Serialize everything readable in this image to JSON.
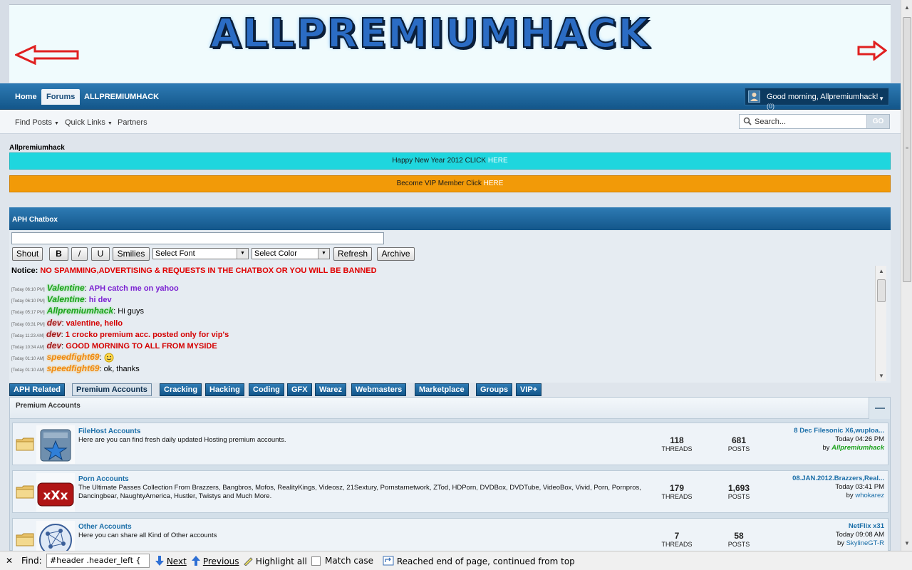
{
  "banner": {
    "logo_text": "ALLPREMIUMHACK"
  },
  "nav": {
    "tabs": [
      "Home",
      "Forums",
      "ALLPREMIUMHACK"
    ],
    "user_greeting": "Good morning, Allpremiumhack!",
    "user_count": "(0)"
  },
  "subnav": {
    "items": [
      "Find Posts",
      "Quick Links",
      "Partners"
    ],
    "search_placeholder": "Search...",
    "search_go": "GO"
  },
  "breadcrumb": "Allpremiumhack",
  "notices": {
    "newyear_text": "Happy New Year 2012 CLICK ",
    "newyear_link": "HERE",
    "vip_text": "Become VIP Member Click ",
    "vip_link": "HERE"
  },
  "chatbox": {
    "title": "APH Chatbox",
    "buttons": {
      "shout": "Shout",
      "bold": "B",
      "italic": "/",
      "underline": "U",
      "smilies": "Smilies",
      "refresh": "Refresh",
      "archive": "Archive"
    },
    "select_font": "Select Font",
    "select_color": "Select Color",
    "notice_label": "Notice:",
    "notice_text": "NO SPAMMING,ADVERTISING & REQUESTS IN THE CHATBOX OR YOU WILL BE BANNED",
    "messages": [
      {
        "time": "[Today 06:10 PM]",
        "user": "Valentine",
        "text": "APH catch me on yahoo"
      },
      {
        "time": "[Today 06:10 PM]",
        "user": "Valentine",
        "text": "hi dev"
      },
      {
        "time": "[Today 05:17 PM]",
        "user": "Allpremiumhack",
        "text": "Hi guys"
      },
      {
        "time": "[Today 03:31 PM]",
        "user": "dev",
        "text": "valentine, hello"
      },
      {
        "time": "[Today 11:23 AM]",
        "user": "dev",
        "text": "1 crocko premium acc. posted only for vip's"
      },
      {
        "time": "[Today 10:34 AM]",
        "user": "dev",
        "text": "GOOD MORNING TO ALL FROM MYSIDE"
      },
      {
        "time": "[Today 01:10 AM]",
        "user": "speedfight69",
        "text": ""
      },
      {
        "time": "[Today 01:10 AM]",
        "user": "speedfight69",
        "text": "ok, thanks"
      }
    ]
  },
  "category_tabs": [
    "APH Related",
    "Premium Accounts",
    "Cracking",
    "Hacking",
    "Coding",
    "GFX",
    "Warez",
    "Webmasters",
    "Marketplace",
    "Groups",
    "VIP+"
  ],
  "forum_section": {
    "title": "Premium Accounts",
    "forums": [
      {
        "title": "FileHost Accounts",
        "desc": "Here are you can find fresh daily updated Hosting premium accounts.",
        "threads": "118",
        "threads_label": "THREADS",
        "posts": "681",
        "posts_label": "POSTS",
        "last_title": "8 Dec Filesonic X6,wuploa...",
        "last_date": "Today 04:26 PM",
        "last_by_prefix": "by ",
        "last_by": "Allpremiumhack"
      },
      {
        "title": "Porn Accounts",
        "desc": "The Ultimate Passes Collection From Brazzers, Bangbros, Mofos, RealityKings, Videosz, 21Sextury, Pornstarnetwork, ZTod, HDPorn, DVDBox, DVDTube, VideoBox, Vivid, Porn, Pornpros, Dancingbear, NaughtyAmerica, Hustler, Twistys and Much More.",
        "threads": "179",
        "threads_label": "THREADS",
        "posts": "1,693",
        "posts_label": "POSTS",
        "last_title": "08.JAN.2012.Brazzers,Real...",
        "last_date": "Today 03:41 PM",
        "last_by_prefix": "by ",
        "last_by": "whokarez"
      },
      {
        "title": "Other Accounts",
        "desc": "Here you can share all Kind of Other accounts",
        "threads": "7",
        "threads_label": "THREADS",
        "posts": "58",
        "posts_label": "POSTS",
        "last_title": "NetFlix x31",
        "last_date": "Today 09:08 AM",
        "last_by_prefix": "by ",
        "last_by": "SkylineGT-R"
      }
    ]
  },
  "findbar": {
    "close": "✕",
    "label": "Find:",
    "value": "#header .header_left {",
    "next": "Next",
    "previous": "Previous",
    "highlight": "Highlight all",
    "match_case": "Match case",
    "status": "Reached end of page, continued from top"
  }
}
